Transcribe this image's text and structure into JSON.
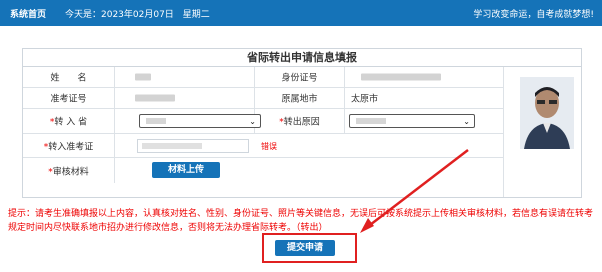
{
  "topbar": {
    "home_label": "系统首页",
    "today_text": "今天是：2023年02月07日　星期二",
    "slogan": "学习改变命运，自考成就梦想!"
  },
  "form": {
    "title": "省际转出申请信息填报",
    "labels": {
      "name": "姓　　名",
      "id_number": "身份证号",
      "exam_number": "准考证号",
      "original_city": "原属地市",
      "province_in": "转 入 省",
      "transfer_reason": "转出原因",
      "new_exam_number": "转入准考证",
      "audit_materials": "审核材料"
    },
    "values": {
      "original_city": "太原市"
    },
    "new_exam_number_error": "错误",
    "upload_button": "材料上传"
  },
  "notice": {
    "prefix": "提示：",
    "text": "请考生准确填报以上内容，认真核对姓名、性别、身份证号、照片等关键信息，无误后可按系统提示上传相关审核材料，若信息有误请在转考规定时间内尽快联系地市招办进行修改信息，否则将无法办理省际转考。（转出）"
  },
  "submit_button": "提交申请",
  "colors": {
    "primary": "#1573b8",
    "required": "#e00000",
    "annotation": "#e02020"
  }
}
